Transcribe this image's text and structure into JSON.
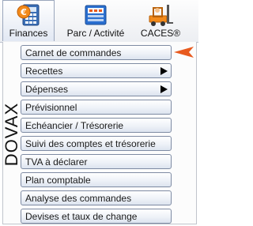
{
  "tabs": [
    {
      "label": "Finances",
      "icon": "finances-icon",
      "selected": true
    },
    {
      "label": "Parc / Activité",
      "icon": "parc-activite-icon",
      "selected": false
    },
    {
      "label": "CACES®",
      "icon": "caces-icon",
      "selected": false
    }
  ],
  "sidebar": {
    "label": "DOVAX"
  },
  "menu": [
    {
      "label": "Carnet de commandes",
      "has_submenu": false
    },
    {
      "label": "Recettes",
      "has_submenu": true
    },
    {
      "label": "Dépenses",
      "has_submenu": true
    },
    {
      "label": "Prévisionnel",
      "has_submenu": false
    },
    {
      "label": "Echéancier / Trésorerie",
      "has_submenu": false
    },
    {
      "label": "Suivi des comptes et trésorerie",
      "has_submenu": false
    },
    {
      "label": "TVA à déclarer",
      "has_submenu": false
    },
    {
      "label": "Plan comptable",
      "has_submenu": false
    },
    {
      "label": "Analyse des commandes",
      "has_submenu": false
    },
    {
      "label": "Devises et taux de change",
      "has_submenu": false
    }
  ],
  "indicator": {
    "icon": "selection-pointer-icon",
    "color": "#e85a1e"
  },
  "colors": {
    "button_border": "#7e8ba3",
    "accent_orange": "#f28a1b",
    "accent_blue": "#2a6fd0"
  }
}
